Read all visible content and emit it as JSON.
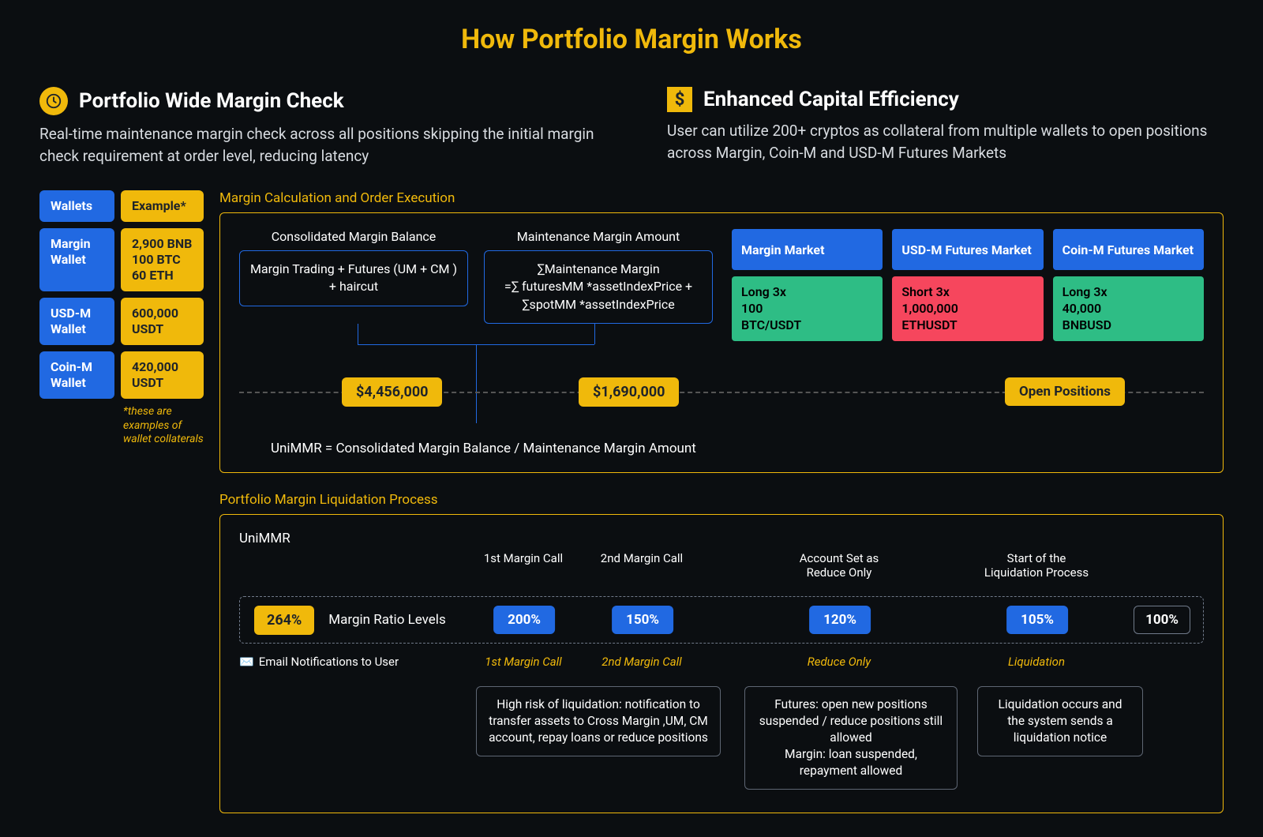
{
  "title": "How Portfolio Margin Works",
  "top": {
    "left": {
      "heading": "Portfolio Wide Margin Check",
      "desc": "Real-time maintenance margin check across all positions skipping the initial margin check requirement at order level, reducing latency"
    },
    "right": {
      "heading": "Enhanced Capital Efficiency",
      "desc": "User can utilize 200+ cryptos as collateral from multiple wallets to open positions across Margin, Coin-M and USD-M Futures Markets"
    }
  },
  "wallets": {
    "header_left": "Wallets",
    "header_right": "Example*",
    "rows": [
      {
        "label": "Margin Wallet",
        "value": "2,900 BNB\n100 BTC\n60 ETH"
      },
      {
        "label": "USD-M Wallet",
        "value": "600,000 USDT"
      },
      {
        "label": "Coin-M Wallet",
        "value": "420,000 USDT"
      }
    ],
    "note": "*these are examples of wallet collaterals"
  },
  "calc_panel": {
    "title": "Margin Calculation and Order Execution",
    "box1_title": "Consolidated Margin Balance",
    "box1_body": "Margin Trading + Futures (UM + CM ) + haircut",
    "box2_title": "Maintenance Margin Amount",
    "box2_body": "∑Maintenance Margin\n=∑ futuresMM *assetIndexPrice + ∑spotMM *assetIndexPrice",
    "val1": "$4,456,000",
    "val2": "$1,690,000",
    "open_positions": "Open Positions",
    "formula": "UniMMR = Consolidated Margin Balance / Maintenance Margin Amount",
    "markets": [
      {
        "name": "Margin Market",
        "side": "long",
        "pos": "Long 3x\n100\nBTC/USDT"
      },
      {
        "name": "USD-M Futures Market",
        "side": "short",
        "pos": "Short 3x\n1,000,000\nETHUSDT"
      },
      {
        "name": "Coin-M Futures Market",
        "side": "long",
        "pos": "Long 3x\n40,000\nBNBUSD"
      }
    ]
  },
  "liq_panel": {
    "title": "Portfolio Margin Liquidation Process",
    "unimmr": "UniMMR",
    "stages": [
      "1st Margin Call",
      "2nd Margin Call",
      "Account Set as Reduce Only",
      "Start of the Liquidation Process"
    ],
    "ratio_start": "264%",
    "ratio_label": "Margin Ratio Levels",
    "levels": [
      "200%",
      "150%",
      "120%",
      "105%"
    ],
    "final_level": "100%",
    "email_label": "Email Notifications to User",
    "sub_labels": [
      "1st Margin Call",
      "2nd Margin Call",
      "Reduce Only",
      "Liquidation"
    ],
    "notes": [
      "High risk of liquidation: notification to transfer assets to Cross Margin ,UM, CM account, repay loans or reduce positions",
      "Futures: open new positions suspended / reduce positions still allowed\nMargin: loan suspended, repayment allowed",
      "Liquidation occurs and the system sends a liquidation notice"
    ]
  }
}
